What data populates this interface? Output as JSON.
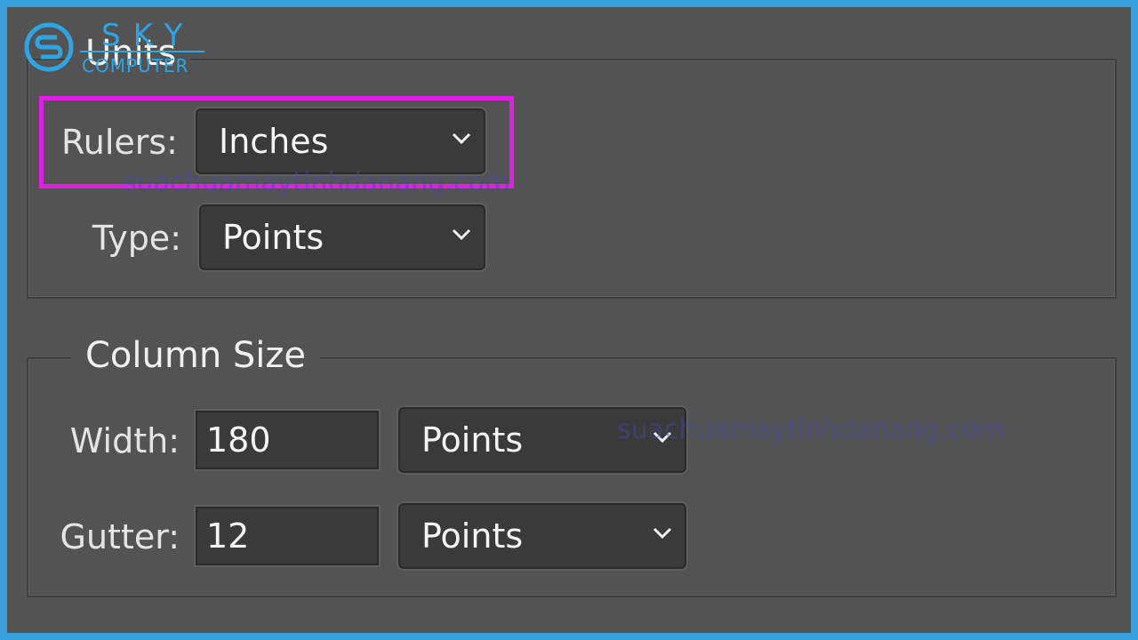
{
  "logo": {
    "brand": "SKY",
    "sub": "COMPUTER"
  },
  "units": {
    "title": "Units",
    "rulers_label": "Rulers:",
    "rulers_value": "Inches",
    "type_label": "Type:",
    "type_value": "Points"
  },
  "column_size": {
    "title": "Column Size",
    "width_label": "Width:",
    "width_value": "180",
    "width_unit": "Points",
    "gutter_label": "Gutter:",
    "gutter_value": "12",
    "gutter_unit": "Points"
  },
  "watermarks": {
    "first": "suachuamaytinhdanang.com",
    "second": "suachuamaytinhdanang.com"
  },
  "colors": {
    "highlight": "#e21de5",
    "frame_border": "#3aa0dc",
    "panel_bg": "#535353",
    "control_bg": "#3a3a3a",
    "logo": "#2fa4e2"
  },
  "icons": {
    "dropdown": "chevron-down-icon",
    "logo_mark": "sky-logo-icon"
  }
}
